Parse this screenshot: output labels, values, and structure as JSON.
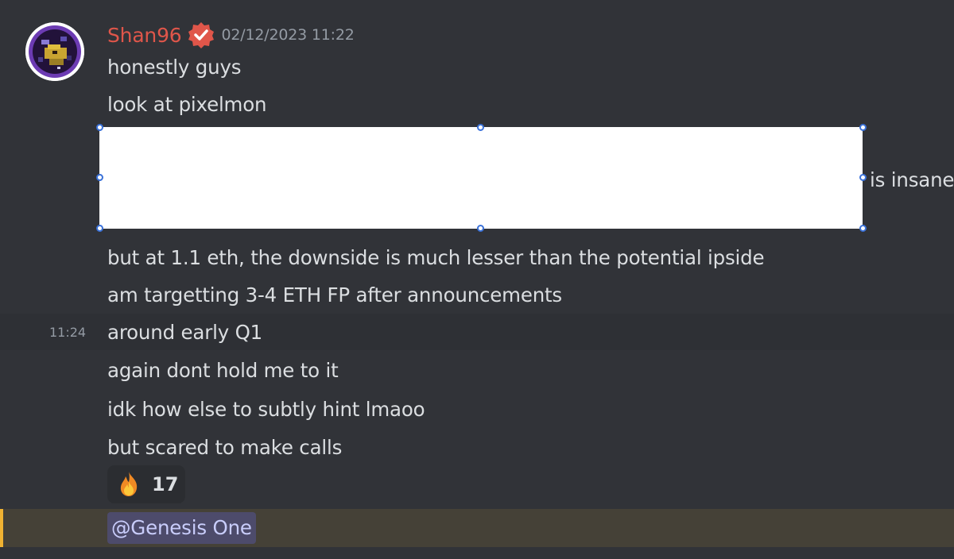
{
  "message": {
    "author": "Shan96",
    "timestamp": "02/12/2023 11:22",
    "lines": [
      "honestly guys",
      "look at pixelmon",
      "is insane",
      "but at 1.1 eth, the downside is much lesser than the potential ipside",
      "am targetting 3-4 ETH FP after announcements",
      "around early Q1",
      "again dont hold me to it",
      "idk how else to subtly hint lmaoo",
      "but scared to make calls"
    ],
    "hover_time": "11:24"
  },
  "reaction": {
    "emoji": "🔥",
    "count": "17"
  },
  "mention": {
    "text": "@Genesis One"
  },
  "colors": {
    "background": "#313338",
    "username": "#e0564a",
    "mention_highlight": "#454137",
    "mention_bar": "#f0b232",
    "selection_handle": "#3b72d9"
  },
  "icons": {
    "verified": "verified-badge-icon",
    "reaction": "fire-icon"
  }
}
